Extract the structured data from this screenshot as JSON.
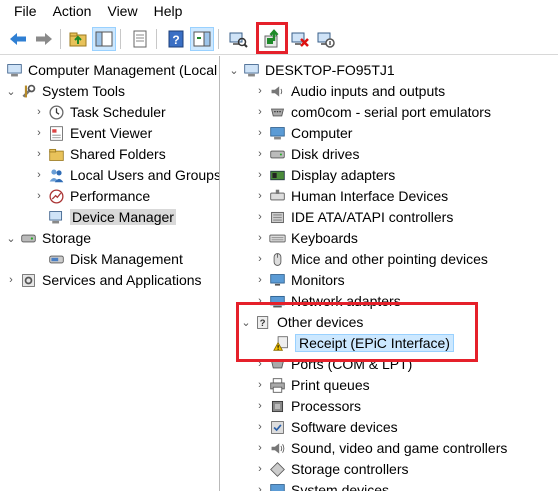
{
  "menu": [
    "File",
    "Action",
    "View",
    "Help"
  ],
  "toolbar": {
    "icons": [
      "back-arrow-icon",
      "forward-arrow-icon",
      "up-folder-icon",
      "show-hide-tree-icon",
      "properties-icon",
      "help-icon",
      "show-hide-action-pane-icon",
      "scan-hardware-icon",
      "update-driver-icon",
      "uninstall-device-icon",
      "disable-device-icon"
    ]
  },
  "left_tree": {
    "root": "Computer Management (Local",
    "system_tools": "System Tools",
    "task_scheduler": "Task Scheduler",
    "event_viewer": "Event Viewer",
    "shared_folders": "Shared Folders",
    "local_users": "Local Users and Groups",
    "performance": "Performance",
    "device_manager": "Device Manager",
    "storage": "Storage",
    "disk_management": "Disk Management",
    "services_apps": "Services and Applications"
  },
  "right_tree": {
    "root": "DESKTOP-FO95TJ1",
    "categories": [
      "Audio inputs and outputs",
      "com0com - serial port emulators",
      "Computer",
      "Disk drives",
      "Display adapters",
      "Human Interface Devices",
      "IDE ATA/ATAPI controllers",
      "Keyboards",
      "Mice and other pointing devices",
      "Monitors",
      "Network adapters",
      "Other devices",
      "Receipt (EPiC Interface)",
      "Ports (COM & LPT)",
      "Print queues",
      "Processors",
      "Software devices",
      "Sound, video and game controllers",
      "Storage controllers",
      "System devices"
    ]
  },
  "colors": {
    "highlight_box": "#e5202a",
    "selection_blue": "#cce8ff",
    "toolbar_pressed": "#cde8ff"
  }
}
